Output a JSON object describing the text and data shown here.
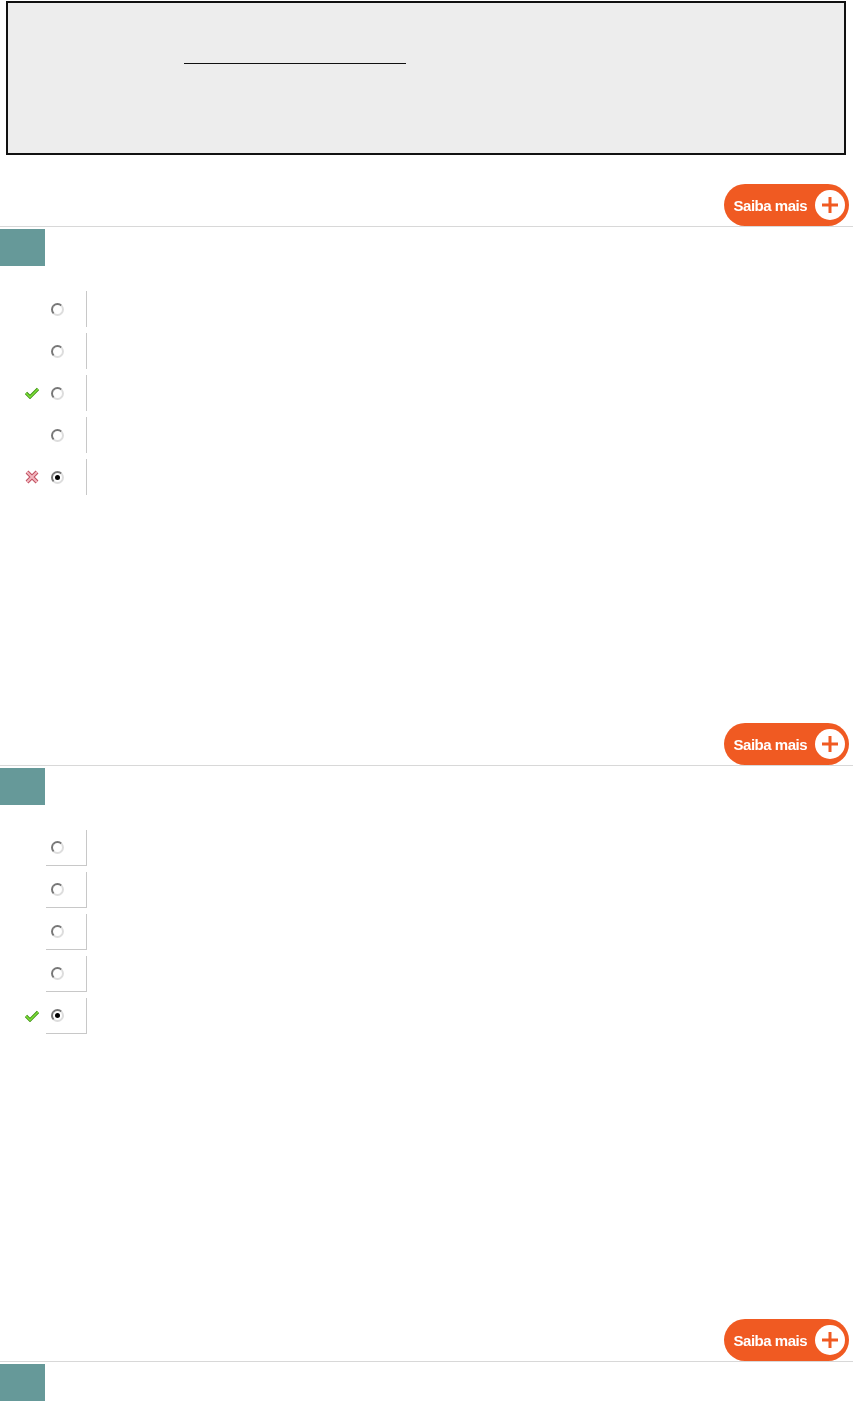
{
  "statement": {
    "blank": true
  },
  "questions": [
    {
      "kind": "plain",
      "button": "Saiba mais",
      "options": [
        {
          "selected": false,
          "correct": false,
          "wrong": false
        },
        {
          "selected": false,
          "correct": false,
          "wrong": false
        },
        {
          "selected": false,
          "correct": true,
          "wrong": false
        },
        {
          "selected": false,
          "correct": false,
          "wrong": false
        },
        {
          "selected": true,
          "correct": false,
          "wrong": true
        }
      ]
    },
    {
      "kind": "boxed",
      "button": "Saiba mais",
      "options": [
        {
          "selected": false,
          "correct": false,
          "wrong": false
        },
        {
          "selected": false,
          "correct": false,
          "wrong": false
        },
        {
          "selected": false,
          "correct": false,
          "wrong": false
        },
        {
          "selected": false,
          "correct": false,
          "wrong": false
        },
        {
          "selected": true,
          "correct": true,
          "wrong": false
        }
      ]
    },
    {
      "button": "Saiba mais"
    }
  ]
}
